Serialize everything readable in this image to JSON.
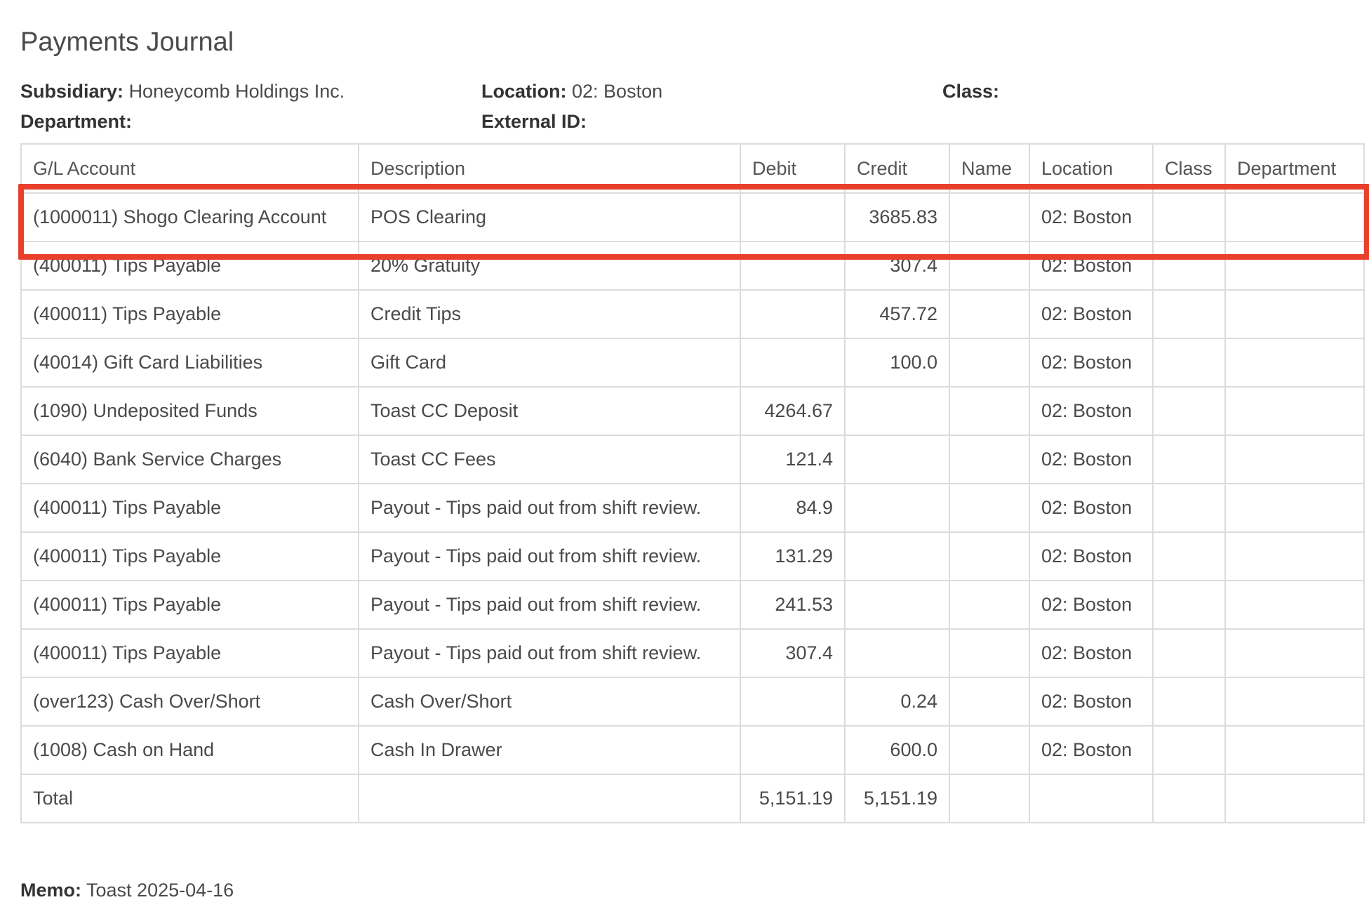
{
  "title": "Payments Journal",
  "meta": {
    "subsidiary_label": "Subsidiary:",
    "subsidiary_value": "Honeycomb Holdings Inc.",
    "location_label": "Location:",
    "location_value": "02: Boston",
    "class_label": "Class:",
    "class_value": "",
    "department_label": "Department:",
    "department_value": "",
    "external_id_label": "External ID:",
    "external_id_value": ""
  },
  "table": {
    "headers": [
      "G/L Account",
      "Description",
      "Debit",
      "Credit",
      "Name",
      "Location",
      "Class",
      "Department"
    ],
    "rows": [
      {
        "account": "(1000011) Shogo Clearing Account",
        "description": "POS Clearing",
        "debit": "",
        "credit": "3685.83",
        "name": "",
        "location": "02: Boston",
        "class": "",
        "department": ""
      },
      {
        "account": "(400011) Tips Payable",
        "description": "20% Gratuity",
        "debit": "",
        "credit": "307.4",
        "name": "",
        "location": "02: Boston",
        "class": "",
        "department": ""
      },
      {
        "account": "(400011) Tips Payable",
        "description": "Credit Tips",
        "debit": "",
        "credit": "457.72",
        "name": "",
        "location": "02: Boston",
        "class": "",
        "department": ""
      },
      {
        "account": "(40014) Gift Card Liabilities",
        "description": "Gift Card",
        "debit": "",
        "credit": "100.0",
        "name": "",
        "location": "02: Boston",
        "class": "",
        "department": ""
      },
      {
        "account": "(1090) Undeposited Funds",
        "description": "Toast CC Deposit",
        "debit": "4264.67",
        "credit": "",
        "name": "",
        "location": "02: Boston",
        "class": "",
        "department": ""
      },
      {
        "account": "(6040) Bank Service Charges",
        "description": "Toast CC Fees",
        "debit": "121.4",
        "credit": "",
        "name": "",
        "location": "02: Boston",
        "class": "",
        "department": ""
      },
      {
        "account": "(400011) Tips Payable",
        "description": "Payout - Tips paid out from shift review.",
        "debit": "84.9",
        "credit": "",
        "name": "",
        "location": "02: Boston",
        "class": "",
        "department": ""
      },
      {
        "account": "(400011) Tips Payable",
        "description": "Payout - Tips paid out from shift review.",
        "debit": "131.29",
        "credit": "",
        "name": "",
        "location": "02: Boston",
        "class": "",
        "department": ""
      },
      {
        "account": "(400011) Tips Payable",
        "description": "Payout - Tips paid out from shift review.",
        "debit": "241.53",
        "credit": "",
        "name": "",
        "location": "02: Boston",
        "class": "",
        "department": ""
      },
      {
        "account": "(400011) Tips Payable",
        "description": "Payout - Tips paid out from shift review.",
        "debit": "307.4",
        "credit": "",
        "name": "",
        "location": "02: Boston",
        "class": "",
        "department": ""
      },
      {
        "account": "(over123) Cash Over/Short",
        "description": "Cash Over/Short",
        "debit": "",
        "credit": "0.24",
        "name": "",
        "location": "02: Boston",
        "class": "",
        "department": ""
      },
      {
        "account": "(1008) Cash on Hand",
        "description": "Cash In Drawer",
        "debit": "",
        "credit": "600.0",
        "name": "",
        "location": "02: Boston",
        "class": "",
        "department": ""
      }
    ],
    "total": {
      "label": "Total",
      "debit": "5,151.19",
      "credit": "5,151.19"
    }
  },
  "highlight_color": "#e8402c",
  "memo": {
    "label": "Memo:",
    "value": "Toast 2025-04-16"
  }
}
